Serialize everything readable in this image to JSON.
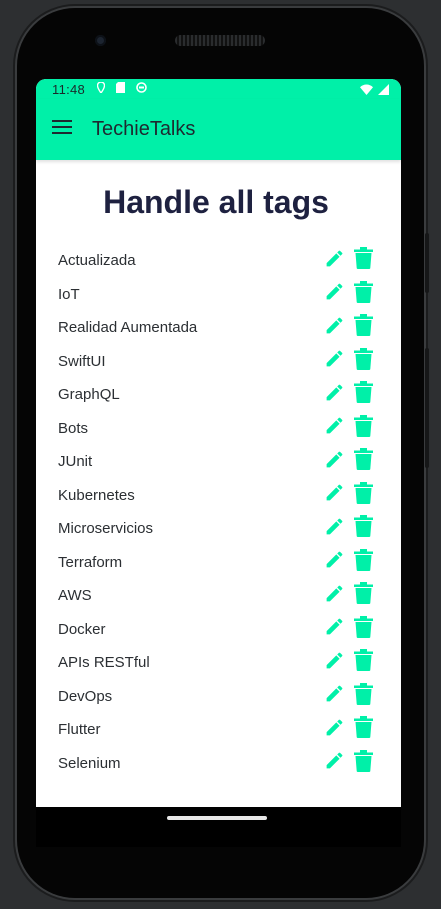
{
  "status_bar": {
    "time": "11:48",
    "icons": [
      "location-icon",
      "sd-card-icon",
      "data-saver-icon",
      "wifi-icon",
      "signal-icon"
    ]
  },
  "app_bar": {
    "title": "TechieTalks",
    "menu_icon": "hamburger-menu-icon"
  },
  "page": {
    "title": "Handle all tags"
  },
  "tags": [
    {
      "name": "Actualizada"
    },
    {
      "name": "IoT"
    },
    {
      "name": "Realidad Aumentada"
    },
    {
      "name": "SwiftUI"
    },
    {
      "name": "GraphQL"
    },
    {
      "name": "Bots"
    },
    {
      "name": "JUnit"
    },
    {
      "name": "Kubernetes"
    },
    {
      "name": "Microservicios"
    },
    {
      "name": "Terraform"
    },
    {
      "name": "AWS"
    },
    {
      "name": "Docker"
    },
    {
      "name": "APIs RESTful"
    },
    {
      "name": "DevOps"
    },
    {
      "name": "Flutter"
    },
    {
      "name": "Selenium"
    }
  ],
  "row_actions": {
    "edit_icon": "pencil-icon",
    "delete_icon": "trash-icon"
  },
  "colors": {
    "accent": "#00f0a8",
    "title_text": "#1e2140",
    "body_text": "#2b2f33"
  }
}
